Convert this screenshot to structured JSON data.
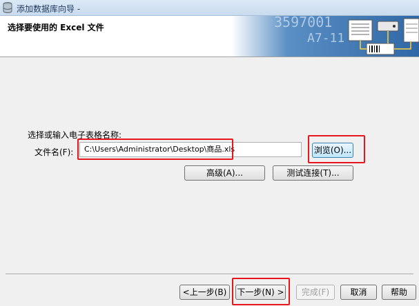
{
  "window": {
    "title": "添加数据库向导 -"
  },
  "header": {
    "heading": "选择要使用的 Excel 文件",
    "banner_text_1": "3597001",
    "banner_text_2": "A7-11"
  },
  "form": {
    "prompt_label": "选择或输入电子表格名称:",
    "file_label": "文件名(F):",
    "file_value": "C:\\Users\\Administrator\\Desktop\\商品.xls",
    "browse_label": "浏览(O)...",
    "advanced_label": "高级(A)...",
    "test_label": "测试连接(T)..."
  },
  "footer": {
    "back_label": "<上一步(B)",
    "next_label": "下一步(N) >",
    "finish_label": "完成(F)",
    "cancel_label": "取消",
    "help_label": "帮助"
  },
  "colors": {
    "highlight": "#e8141b",
    "accent": "#3c7fb1"
  }
}
